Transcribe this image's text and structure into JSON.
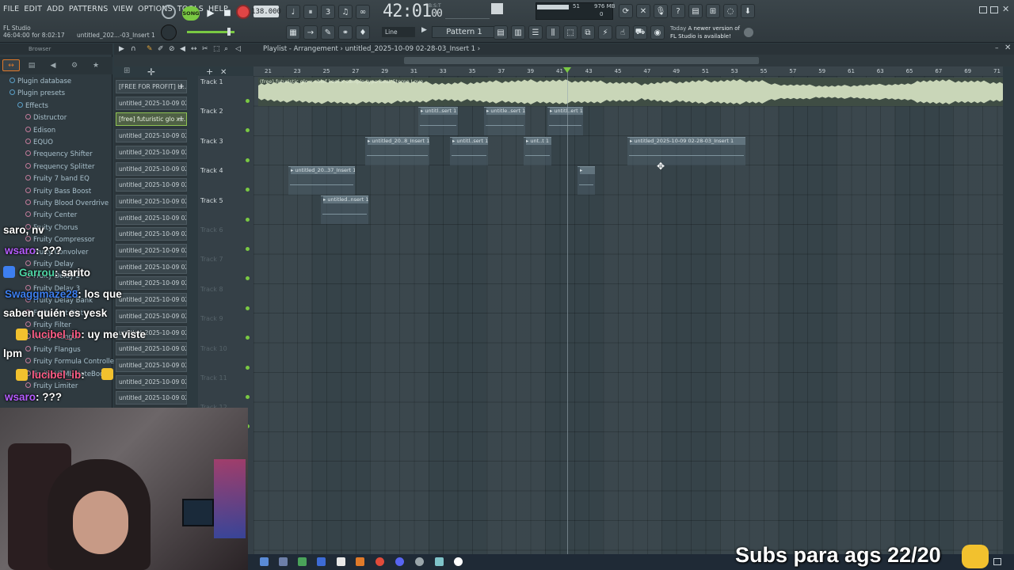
{
  "menu": [
    "FILE",
    "EDIT",
    "ADD",
    "PATTERNS",
    "VIEW",
    "OPTIONS",
    "TOOLS",
    "HELP"
  ],
  "transport": {
    "mode": "SONG",
    "tempo": "138.000",
    "time": "42:01",
    "time_sub": "00",
    "time_unit": "B:S:T"
  },
  "cpu": {
    "value1": "51",
    "memory": "976 MB",
    "value3": "0"
  },
  "project": {
    "app": "FL Studio",
    "duration": "46:04:00 for 8:02:17",
    "name": "untitled_202...-03_Insert 1"
  },
  "toolbar": {
    "snap": "Line",
    "pattern": "Pattern 1"
  },
  "news": {
    "when": "Today",
    "text": "A newer version of",
    "text2": "FL Studio is available!"
  },
  "browser": {
    "title": "Browser",
    "items": [
      {
        "label": "Plugin database",
        "indent": 0
      },
      {
        "label": "Plugin presets",
        "indent": 0
      },
      {
        "label": "Effects",
        "indent": 1
      },
      {
        "label": "Distructor",
        "indent": 2
      },
      {
        "label": "Edison",
        "indent": 2
      },
      {
        "label": "EQUO",
        "indent": 2
      },
      {
        "label": "Frequency Shifter",
        "indent": 2
      },
      {
        "label": "Frequency Splitter",
        "indent": 2
      },
      {
        "label": "Fruity 7 band EQ",
        "indent": 2
      },
      {
        "label": "Fruity Bass Boost",
        "indent": 2
      },
      {
        "label": "Fruity Blood Overdrive",
        "indent": 2
      },
      {
        "label": "Fruity Center",
        "indent": 2
      },
      {
        "label": "Fruity Chorus",
        "indent": 2
      },
      {
        "label": "Fruity Compressor",
        "indent": 2
      },
      {
        "label": "Fruity Convolver",
        "indent": 2
      },
      {
        "label": "Fruity Delay",
        "indent": 2
      },
      {
        "label": "Fruity Delay 2",
        "indent": 2
      },
      {
        "label": "Fruity Delay 3",
        "indent": 2
      },
      {
        "label": "Fruity Delay Bank",
        "indent": 2
      },
      {
        "label": "Fruity Fast Dist",
        "indent": 2
      },
      {
        "label": "Fruity Filter",
        "indent": 2
      },
      {
        "label": "Fruity Flanger",
        "indent": 2
      },
      {
        "label": "Fruity Flangus",
        "indent": 2
      },
      {
        "label": "Fruity Formula Controller",
        "indent": 2
      },
      {
        "label": "Fruity HTML NoteBook",
        "indent": 2
      },
      {
        "label": "Fruity Limiter",
        "indent": 2
      }
    ]
  },
  "channels": [
    "[FREE FOR PROFIT] Li...",
    "untitled_2025-10-09 02-...",
    "[free] futuristic glo x...",
    "untitled_2025-10-09 02-...",
    "untitled_2025-10-09 02-...",
    "untitled_2025-10-09 02-...",
    "untitled_2025-10-09 02-...",
    "untitled_2025-10-09 02-...",
    "untitled_2025-10-09 02-...",
    "untitled_2025-10-09 02-...",
    "untitled_2025-10-09 02-...",
    "untitled_2025-10-09 02-...",
    "untitled_2025-10-09 02-...",
    "untitled_2025-10-09 02-...",
    "untitled_2025-10-09 02-...",
    "untitled_2025-10-09 02-...",
    "untitled_2025-10-09 02-...",
    "untitled_2025-10-09 02-...",
    "untitled_2025-10-09 02-...",
    "untitled_2025-10-09 02-..."
  ],
  "playlist": {
    "title": "Playlist - Arrangement",
    "breadcrumb": "untitled_2025-10-09 02-28-03_Insert 1",
    "ruler": [
      "21",
      "23",
      "25",
      "27",
      "29",
      "31",
      "33",
      "35",
      "37",
      "39",
      "41",
      "43",
      "45",
      "47",
      "49",
      "51",
      "53",
      "55",
      "57",
      "59",
      "61",
      "63",
      "65",
      "67",
      "69",
      "71"
    ],
    "tracks": [
      "Track 1",
      "Track 2",
      "Track 3",
      "Track 4",
      "Track 5",
      "Track 6",
      "Track 7",
      "Track 8",
      "Track 9",
      "Track 10",
      "Track 11",
      "Track 12"
    ],
    "audio_clip": "(free) futuristic glo x chief keef x sample type beat Stereo Love",
    "clips": [
      {
        "track": 2,
        "label": "untitl..sert 1"
      },
      {
        "track": 2,
        "label": "untitle..sert 1"
      },
      {
        "track": 2,
        "label": "untitl..ert 1"
      },
      {
        "track": 3,
        "label": "untitled_20..8_Insert 1"
      },
      {
        "track": 3,
        "label": "untitl..sert 1"
      },
      {
        "track": 3,
        "label": "unt..t 1"
      },
      {
        "track": 3,
        "label": "untitled_2025-10-09 02-28-03_Insert 1"
      },
      {
        "track": 4,
        "label": "untitled_20..37_Insert 1"
      },
      {
        "track": 4,
        "label": ""
      },
      {
        "track": 5,
        "label": "untitled..nsert 1"
      }
    ]
  },
  "chat": [
    {
      "user": "",
      "text": "saro, nv"
    },
    {
      "user": "wsaro",
      "text": ": ???",
      "color": "purple"
    },
    {
      "user": "Garrou",
      "text": ": sarito",
      "color": "green"
    },
    {
      "user": "Swaggmaze28",
      "text": ": los que",
      "color": "blue"
    },
    {
      "user": "",
      "text": "saben quién es yesk"
    },
    {
      "user": "lucibel_ib",
      "text": ": uy me viste",
      "color": "pink"
    },
    {
      "user": "",
      "text": "lpm"
    },
    {
      "user": "lucibel_ib",
      "text": ":",
      "color": "pink"
    },
    {
      "user": "wsaro",
      "text": ": ???",
      "color": "purple"
    }
  ],
  "overlay": {
    "subs": "Subs para ags 22/20"
  }
}
